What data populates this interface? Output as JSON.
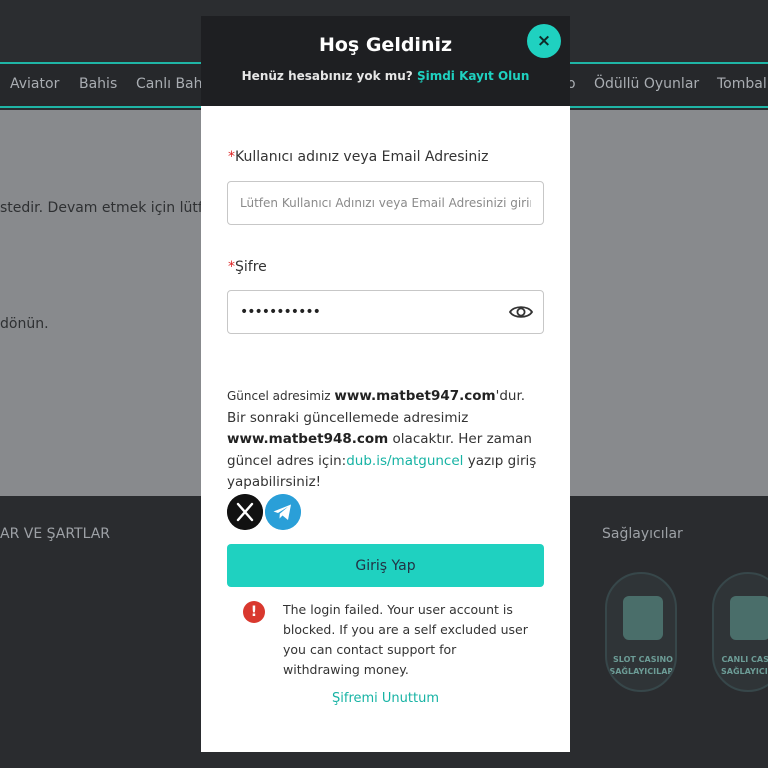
{
  "background": {
    "nav_items": [
      "Aviator",
      "Bahis",
      "Canlı Bah",
      "o",
      "Ödüllü Oyunlar",
      "Tombal"
    ],
    "content_lines": [
      "stedir. Devam etmek için lütfen",
      "dönün."
    ],
    "footer_headings": [
      "AR VE ŞARTLAR",
      "Sağlayıcılar"
    ],
    "providers": [
      {
        "line1": "SLOT CASINO",
        "line2": "SAĞLAYICILARI"
      },
      {
        "line1": "CANLI CASIN",
        "line2": "SAĞLAYICILA"
      }
    ]
  },
  "modal": {
    "title": "Hoş Geldiniz",
    "subtitle_prefix": "Henüz hesabınız yok mu?",
    "subtitle_link": "Şimdi Kayıt Olun",
    "close_icon": "×",
    "username": {
      "required_mark": "*",
      "label": "Kullanıcı adınız veya Email Adresiniz",
      "placeholder": "Lütfen Kullanıcı Adınızı veya Email Adresinizi girin",
      "value": ""
    },
    "password": {
      "required_mark": "*",
      "label": "Şifre",
      "value": "•••••••••••"
    },
    "info": {
      "part1": "Güncel adresimiz ",
      "current_domain": "www.matbet947.com",
      "part2": "'dur. Bir sonraki güncellemede adresimiz ",
      "next_domain": "www.matbet948.com",
      "part3": " olacaktır. Her zaman güncel adres için:",
      "link": "dub.is/matguncel",
      "part4": " yazıp giriş yapabilirsiniz!"
    },
    "socials": [
      "x-icon",
      "telegram-icon"
    ],
    "login_button": "Giriş Yap",
    "error": {
      "icon": "!",
      "message": "The login failed. Your user account is blocked. If you are a self excluded user you can contact support for withdrawing money."
    },
    "forgot_password": "Şifremi Unuttum"
  },
  "colors": {
    "accent": "#1fd1c0",
    "error": "#d9382e",
    "header_bg": "#1e1f22"
  }
}
